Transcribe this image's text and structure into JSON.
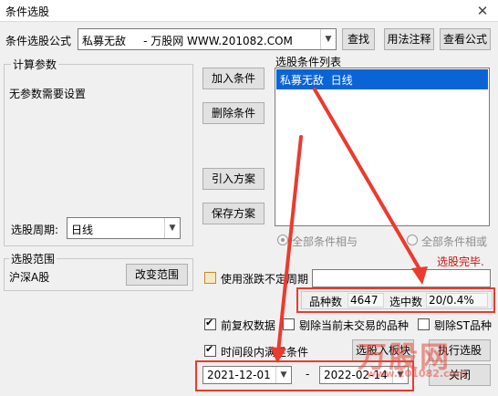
{
  "window": {
    "title": "条件选股"
  },
  "formula": {
    "label": "条件选股公式",
    "value": "私募无敌     - 万股网 WWW.201082.COM"
  },
  "buttons": {
    "find": "查找",
    "usage": "用法注释",
    "view": "查看公式",
    "add": "加入条件",
    "delete": "删除条件",
    "import": "引入方案",
    "save": "保存方案",
    "change_range": "改变范围",
    "add_block": "选股入板块",
    "execute": "执行选股",
    "close": "关闭"
  },
  "params": {
    "title": "计算参数",
    "text": "无参数需要设置",
    "period_label": "选股周期:",
    "period_value": "日线"
  },
  "conditions": {
    "title": "选股条件列表",
    "items": [
      "私募无敌  日线"
    ],
    "mode_and": "全部条件相与",
    "mode_or": "全部条件相或"
  },
  "range": {
    "title": "选股范围",
    "value": "沪深A股"
  },
  "status": {
    "done": "选股完毕.",
    "count_label": "品种数",
    "count_value": "4647",
    "selected_label": "选中数",
    "selected_value": "20/0.4%"
  },
  "options": {
    "limit_label": "使用涨跌不定周期",
    "adjust_label": "前复权数据",
    "exclude_untraded_label": "剔除当前未交易的品种",
    "exclude_st_label": "剔除ST品种",
    "period_condition_label": "时间段内满足条件"
  },
  "dates": {
    "start": "2021-12-01",
    "sep": "-",
    "end": "2022-02-14"
  },
  "watermark": {
    "main": "万股网",
    "sub": "www.201082.com"
  },
  "colors": {
    "highlight": "#0a64d6",
    "annotation": "#ea3b2e",
    "status": "#d01010"
  }
}
